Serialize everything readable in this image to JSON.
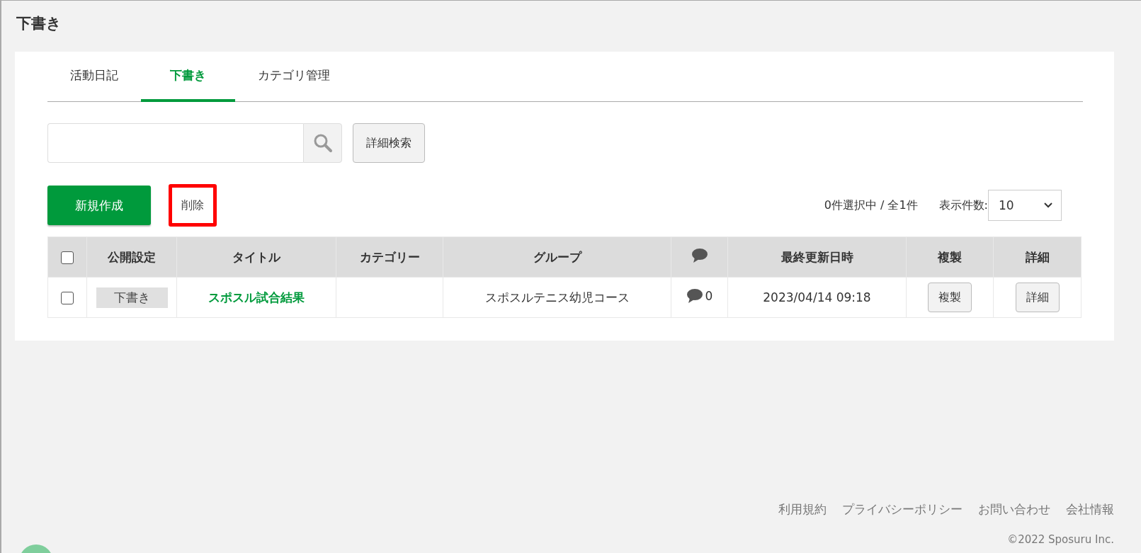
{
  "page_title": "下書き",
  "tabs": [
    {
      "label": "活動日記",
      "selected": false
    },
    {
      "label": "下書き",
      "selected": true
    },
    {
      "label": "カテゴリ管理",
      "selected": false
    }
  ],
  "search": {
    "button": "詳細検索"
  },
  "actions": {
    "create": "新規作成",
    "delete": {
      "label": "削除",
      "highlighted": true
    },
    "selection_status": "0件選択中 / 全1件",
    "page_size_label": "表示件数:",
    "page_size": "10"
  },
  "table": {
    "select_all_checked": false,
    "columns": [
      {
        "kind": "check"
      },
      {
        "kind": "text",
        "label": "公開設定"
      },
      {
        "kind": "text",
        "label": "タイトル"
      },
      {
        "kind": "text",
        "label": "カテゴリー"
      },
      {
        "kind": "text",
        "label": "グループ"
      },
      {
        "kind": "icon"
      },
      {
        "kind": "text",
        "label": "最終更新日時"
      },
      {
        "kind": "text",
        "label": "複製"
      },
      {
        "kind": "text",
        "label": "詳細"
      }
    ],
    "rows": [
      {
        "checked": false,
        "status": "下書き",
        "title": "スポスル試合結果",
        "group": "スポスルテニス幼児コース",
        "comments": "0",
        "updated": "2023/04/14 09:18",
        "copy": "複製",
        "detail": "詳細"
      }
    ]
  },
  "footer": {
    "links": [
      "利用規約",
      "プライバシーポリシー",
      "お問い合わせ",
      "会社情報"
    ],
    "copyright": "©2022 Sposuru Inc."
  }
}
